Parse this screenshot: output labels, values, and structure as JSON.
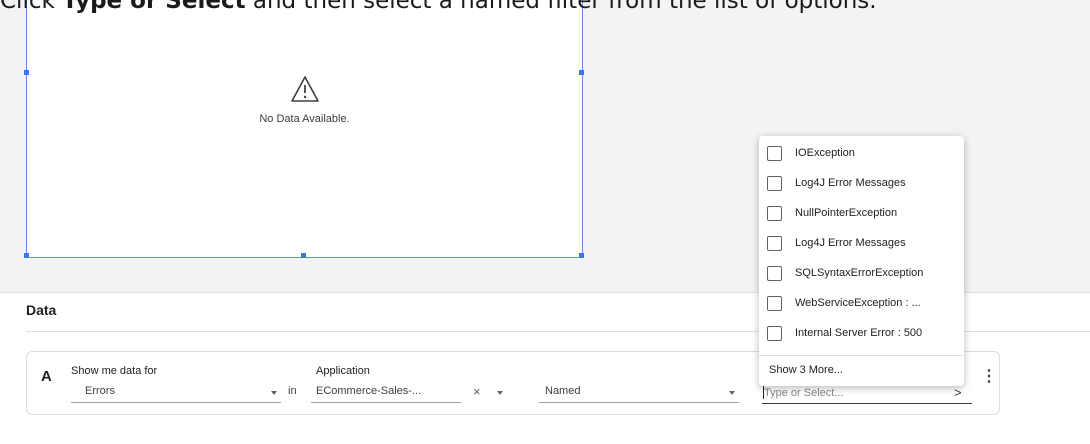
{
  "instruction": {
    "prefix": "Click ",
    "bold": "Type or Select",
    "suffix": " and then select a named filter from the list of options."
  },
  "widget": {
    "empty_message": "No Data Available."
  },
  "section": {
    "title": "Data"
  },
  "query_row": {
    "letter": "A",
    "show_label": "Show me data for",
    "show_value": "Errors",
    "in_label": "in",
    "app_label": "Application",
    "app_value": "ECommerce-Sales-...",
    "clear_symbol": "×",
    "filter_value": "Named",
    "type_placeholder": "Type or Select...",
    "chevron": ">",
    "kebab": "⋮"
  },
  "dropdown": {
    "options": [
      "IOException",
      "Log4J Error Messages",
      "NullPointerException",
      "Log4J Error Messages",
      "SQLSyntaxErrorException",
      "WebServiceException : ...",
      "Internal Server Error : 500"
    ],
    "show_more": "Show 3 More..."
  },
  "colors": {
    "accent": "#3b78e7",
    "canvas_bg": "#f1f3f4"
  }
}
